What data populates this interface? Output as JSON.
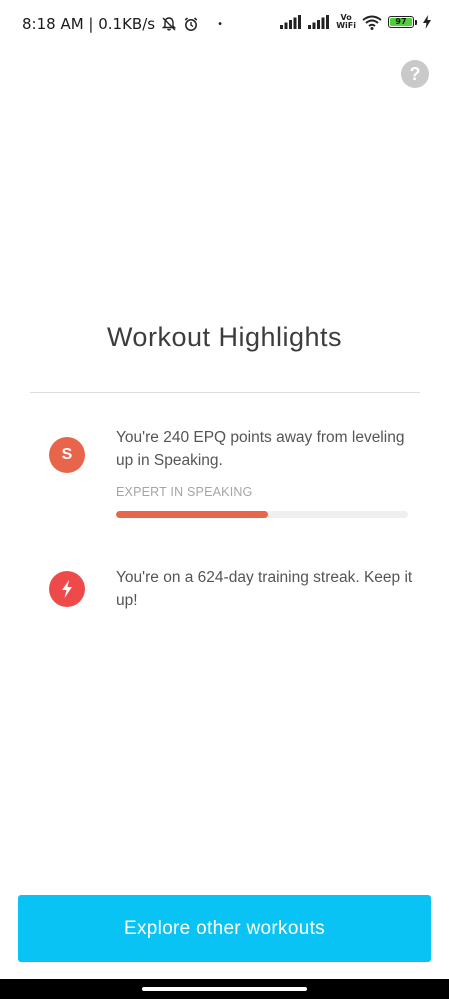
{
  "status_bar": {
    "time_speed": "8:18 AM | 0.1KB/s",
    "dot": "•",
    "vo_label": "Vo",
    "wifi_label": "WiFi",
    "battery_level": "97"
  },
  "help": {
    "label": "?"
  },
  "title": "Workout Highlights",
  "highlights": [
    {
      "icon_letter": "S",
      "icon_color": "#e8644a",
      "text": "You're 240 EPQ points away from leveling up in Speaking.",
      "caption": "EXPERT IN SPEAKING",
      "progress": 0.52
    },
    {
      "icon_name": "lightning-icon",
      "icon_color": "#ef4a4a",
      "text": "You're on a 624-day training streak. Keep it up!"
    }
  ],
  "cta": {
    "label": "Explore other workouts",
    "color": "#0ac3f5"
  }
}
